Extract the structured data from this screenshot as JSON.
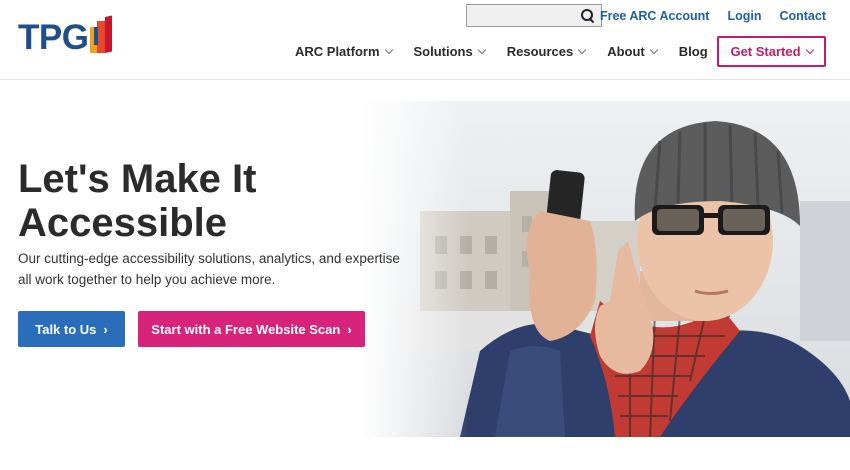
{
  "brand": {
    "logo_text": "TPGi",
    "logo_reg": "®"
  },
  "search": {
    "placeholder": "",
    "value": ""
  },
  "utility_links": [
    "Free ARC Account",
    "Login",
    "Contact"
  ],
  "nav": {
    "items": [
      "ARC Platform",
      "Solutions",
      "Resources",
      "About"
    ],
    "blog": "Blog",
    "cta": "Get Started"
  },
  "hero": {
    "title_line1": "Let's Make It",
    "title_line2": "Accessible",
    "subtitle": "Our cutting-edge accessibility solutions, analytics, and expertise all work together to help you achieve more.",
    "btn_talk": "Talk to Us",
    "btn_scan": "Start with a Free Website Scan",
    "arrow": "›"
  },
  "colors": {
    "brand_blue": "#1e4f8a",
    "link_blue": "#1f5fa8",
    "button_blue": "#2a6ebb",
    "accent_magenta": "#d8237b"
  },
  "icons": {
    "search": "search-icon",
    "dropdown": "chevron-down-icon",
    "arrow": "chevron-right-icon"
  }
}
